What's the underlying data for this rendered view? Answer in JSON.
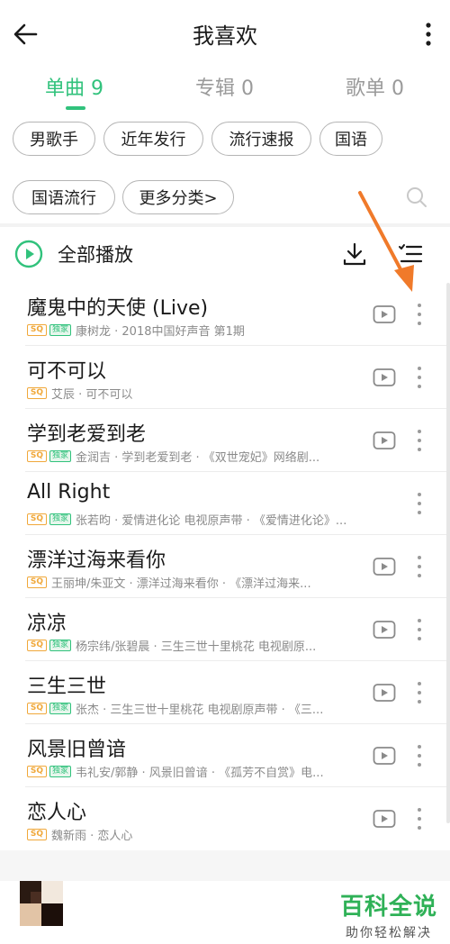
{
  "header": {
    "title": "我喜欢",
    "back_icon": "arrow-left-icon",
    "more_icon": "vertical-dots-icon"
  },
  "tabs": [
    {
      "label": "单曲 9",
      "active": true
    },
    {
      "label": "专辑 0",
      "active": false
    },
    {
      "label": "歌单 0",
      "active": false
    }
  ],
  "filters": {
    "chips": [
      "男歌手",
      "近年发行",
      "流行速报",
      "国语",
      "国语流行",
      "更多分类>"
    ],
    "search_icon": "search-icon"
  },
  "play_all": {
    "label": "全部播放",
    "play_icon": "play-circle-icon",
    "download_icon": "download-icon",
    "list_icon": "list-menu-icon"
  },
  "songs": [
    {
      "title": "魔鬼中的天使 (Live)",
      "sq": "SQ",
      "exclusive": "独家",
      "meta": "康树龙 · 2018中国好声音 第1期",
      "has_mv": true
    },
    {
      "title": "可不可以",
      "sq": "SQ",
      "exclusive": "",
      "meta": "艾辰 · 可不可以",
      "has_mv": true
    },
    {
      "title": "学到老爱到老",
      "sq": "SQ",
      "exclusive": "独家",
      "meta": "金润吉 · 学到老爱到老 · 《双世宠妃》网络剧...",
      "has_mv": true
    },
    {
      "title": "All Right",
      "sq": "SQ",
      "exclusive": "独家",
      "meta": "张若昀 · 爱情进化论 电视原声带 · 《爱情进化论》...",
      "has_mv": false
    },
    {
      "title": "漂洋过海来看你",
      "sq": "SQ",
      "exclusive": "",
      "meta": "王丽坤/朱亚文 · 漂洋过海来看你 · 《漂洋过海来...",
      "has_mv": true
    },
    {
      "title": "凉凉",
      "sq": "SQ",
      "exclusive": "独家",
      "meta": "杨宗纬/张碧晨 · 三生三世十里桃花 电视剧原...",
      "has_mv": true
    },
    {
      "title": "三生三世",
      "sq": "SQ",
      "exclusive": "独家",
      "meta": "张杰 · 三生三世十里桃花 电视剧原声带 · 《三...",
      "has_mv": true
    },
    {
      "title": "风景旧曾谙",
      "sq": "SQ",
      "exclusive": "独家",
      "meta": "韦礼安/郭静 · 风景旧曾谙 · 《孤芳不自赏》电...",
      "has_mv": true
    },
    {
      "title": "恋人心",
      "sq": "SQ",
      "exclusive": "",
      "meta": "魏新雨 · 恋人心",
      "has_mv": true
    }
  ],
  "watermark": {
    "title": "百科全说",
    "subtitle": "助你轻松解决"
  },
  "colors": {
    "accent": "#31c27c",
    "sq_badge": "#f0a83a",
    "annotation_arrow": "#f07a2a"
  }
}
